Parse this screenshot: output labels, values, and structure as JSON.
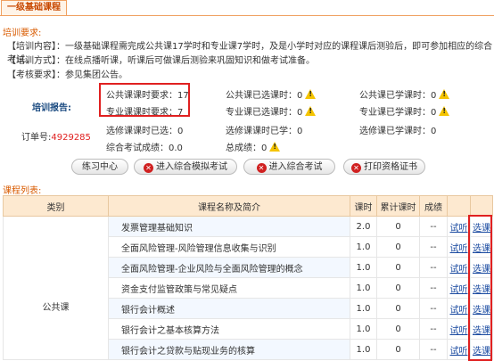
{
  "tab": {
    "label": "一级基础课程"
  },
  "requirements": {
    "title": "培训要求:",
    "lines": [
      "【培训内容】：一级基础课程需完成公共课17学时和专业课7学时，及是小学时对应的课程课后测验后，即可参加相应的综合考试。",
      "【培训方式】：在线点播听课，听课后可做课后测验来巩固知识和做考试准备。",
      "【考核要求】：参见集团公告。"
    ]
  },
  "report": {
    "label": "培训报告:",
    "order_label": "订单号:",
    "order_no": "4929285",
    "public_required": "公共课课时要求：17",
    "pro_required": "专业课课时要求：7",
    "elective_selected": "选修课课时已选：0",
    "exam_score": "综合考试成绩：0.0",
    "public_selected": "公共课已选课时：0",
    "pro_selected": "专业课已选课时：0",
    "elective_learned": "选修课课时已学：0",
    "total_score": "总成绩：0",
    "public_learned": "公共课已学课时：0",
    "pro_learned": "专业课已学课时：0",
    "elective_learned2": "选修课已学课时：0"
  },
  "buttons": {
    "practice": "练习中心",
    "mock_exam": "进入综合模拟考试",
    "exam": "进入综合考试",
    "print_cert": "打印资格证书"
  },
  "course_list": {
    "title": "课程列表:",
    "headers": [
      "类别",
      "课程名称及简介",
      "课时",
      "累计课时",
      "成绩",
      "",
      ""
    ],
    "category": "公共课",
    "trial_label": "试听",
    "select_label": "选课",
    "rows": [
      {
        "name": "发票管理基础知识",
        "hours": "2.0",
        "cum": "0",
        "score": "--"
      },
      {
        "name": "全面风险管理-风险管理信息收集与识别",
        "hours": "1.0",
        "cum": "0",
        "score": "--"
      },
      {
        "name": "全面风险管理-企业风险与全面风险管理的概念",
        "hours": "1.0",
        "cum": "0",
        "score": "--"
      },
      {
        "name": "资金支付监管政策与常见疑点",
        "hours": "1.0",
        "cum": "0",
        "score": "--"
      },
      {
        "name": "银行会计概述",
        "hours": "1.0",
        "cum": "0",
        "score": "--"
      },
      {
        "name": "银行会计之基本核算方法",
        "hours": "1.0",
        "cum": "0",
        "score": "--"
      },
      {
        "name": "银行会计之贷款与贴现业务的核算",
        "hours": "1.0",
        "cum": "0",
        "score": "--"
      }
    ]
  }
}
